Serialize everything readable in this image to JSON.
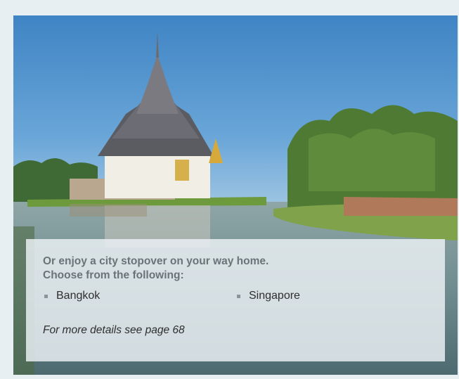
{
  "stopover": {
    "headline_line1": "Or enjoy a city stopover on your way home.",
    "headline_line2": "Choose from the following:",
    "cities": [
      "Bangkok",
      "Singapore"
    ],
    "details": "For more details see page 68"
  },
  "colors": {
    "frame": "#e8eff2",
    "sky": "#4b8fc9",
    "panel": "#e8eff2",
    "headline": "#6a7478",
    "bullet": "#8a9598"
  }
}
